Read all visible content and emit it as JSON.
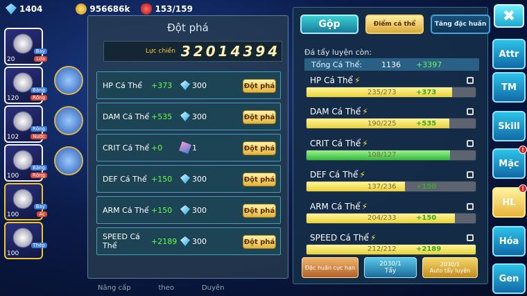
{
  "resources": {
    "gems": "1404",
    "gold": "956686k",
    "stamina": "153/159"
  },
  "party": [
    {
      "level": "20",
      "tag1": "Bay",
      "tag2": "Lửa",
      "gold": false
    },
    {
      "level": "120",
      "tag1": "Băng",
      "tag2": "Rồng",
      "gold": false
    },
    {
      "level": "102",
      "tag1": "Rồng",
      "tag2": "Nước",
      "gold": false
    },
    {
      "level": "100",
      "tag1": "Băng",
      "tag2": "Rồng",
      "gold": false
    },
    {
      "level": "100",
      "tag1": "Bay",
      "tag2": "Ác",
      "gold": true
    },
    {
      "level": "100",
      "tag1": "Thép",
      "tag2": "",
      "gold": true
    }
  ],
  "breakthrough": {
    "title": "Đột phá",
    "power_label": "Lực chiến",
    "power_value": "32014394",
    "button_label": "Đột phá",
    "rows": [
      {
        "name": "HP Cá Thể",
        "plus": "+373",
        "cost": "300",
        "icon": "gem-icon"
      },
      {
        "name": "DAM Cá Thể",
        "plus": "+535",
        "cost": "300",
        "icon": "gem-icon"
      },
      {
        "name": "CRIT Cá Thể",
        "plus": "+0",
        "cost": "1",
        "icon": "scroll-icon"
      },
      {
        "name": "DEF Cá Thể",
        "plus": "+150",
        "cost": "300",
        "icon": "gem-icon"
      },
      {
        "name": "ARM Cá Thể",
        "plus": "+150",
        "cost": "300",
        "icon": "gem-icon"
      },
      {
        "name": "SPEED Cá Thể",
        "plus": "+2189",
        "cost": "300",
        "icon": "gem-icon"
      }
    ],
    "footer": [
      "Nâng cấp",
      "theo",
      "Duyên"
    ]
  },
  "training": {
    "tabs": [
      "Gộp",
      "Điểm cá thể",
      "Tăng đặc huấn"
    ],
    "remaining_label": "Đá tẩy luyện còn:",
    "total_label": "Tổng Cá Thể:",
    "total_value": "1136",
    "total_plus": "+3397",
    "stats": [
      {
        "name": "HP Cá Thể",
        "value": "235/273",
        "plus": "+373",
        "fill": 0.861,
        "green": false
      },
      {
        "name": "DAM Cá Thể",
        "value": "190/225",
        "plus": "+535",
        "fill": 0.844,
        "green": false
      },
      {
        "name": "CRIT Cá Thể",
        "value": "108/127",
        "plus": "",
        "fill": 0.85,
        "green": true
      },
      {
        "name": "DEF Cá Thể",
        "value": "137/236",
        "plus": "+150",
        "fill": 0.58,
        "green": false
      },
      {
        "name": "ARM Cá Thể",
        "value": "204/233",
        "plus": "+150",
        "fill": 0.876,
        "green": false
      },
      {
        "name": "SPEED Cá Thể",
        "value": "212/212",
        "plus": "+2189",
        "fill": 1.0,
        "green": false
      }
    ],
    "buttons": {
      "special": "Đặc huấn cực hạn",
      "wash_count": "2030/1",
      "wash_label": "Tẩy",
      "auto_count": "2030/1",
      "auto_label": "Auto tẩy luyện"
    }
  },
  "nav": {
    "close": "✖",
    "items": [
      {
        "label": "Attr",
        "badge": false,
        "active": false
      },
      {
        "label": "TM",
        "badge": false,
        "active": false
      },
      {
        "label": "Skill",
        "badge": false,
        "active": false
      },
      {
        "label": "Mặc",
        "badge": true,
        "active": false
      },
      {
        "label": "HL",
        "badge": true,
        "active": true
      },
      {
        "label": "Hóa",
        "badge": false,
        "active": false
      },
      {
        "label": "Gen",
        "badge": false,
        "active": false
      }
    ]
  }
}
